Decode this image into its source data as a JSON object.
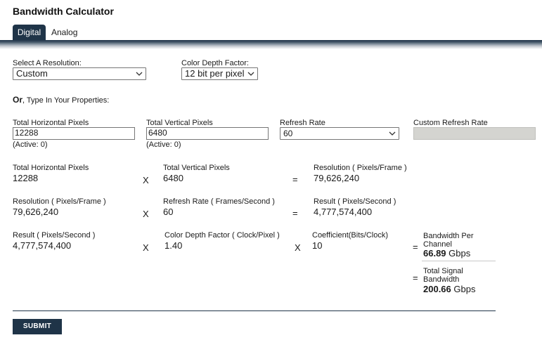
{
  "app": {
    "title": "Bandwidth Calculator"
  },
  "tabs": [
    {
      "label": "Digital",
      "active": true
    },
    {
      "label": "Analog",
      "active": false
    }
  ],
  "form": {
    "resolution_label": "Select A Resolution:",
    "resolution_value": "Custom",
    "color_depth_label": "Color Depth Factor:",
    "color_depth_value": "12 bit per pixel",
    "or_text": "Or",
    "or_rest": ", Type In Your Properties:",
    "h_pixels_label": "Total Horizontal Pixels",
    "h_pixels_value": "12288",
    "h_pixels_active": "(Active: 0)",
    "v_pixels_label": "Total Vertical Pixels",
    "v_pixels_value": "6480",
    "v_pixels_active": "(Active: 0)",
    "refresh_label": "Refresh Rate",
    "refresh_value": "60",
    "custom_refresh_label": "Custom Refresh Rate",
    "custom_refresh_value": ""
  },
  "calc": {
    "row1": {
      "a_label": "Total Horizontal Pixels",
      "a_value": "12288",
      "op1": "X",
      "b_label": "Total Vertical Pixels",
      "b_value": "6480",
      "op2": "=",
      "r_label": "Resolution ( Pixels/Frame )",
      "r_value": "79,626,240"
    },
    "row2": {
      "a_label": "Resolution ( Pixels/Frame )",
      "a_value": "79,626,240",
      "op1": "X",
      "b_label": "Refresh Rate ( Frames/Second )",
      "b_value": "60",
      "op2": "=",
      "r_label": "Result ( Pixels/Second )",
      "r_value": "4,777,574,400"
    },
    "row3": {
      "a_label": "Result ( Pixels/Second )",
      "a_value": "4,777,574,400",
      "op1": "X",
      "b_label": "Color Depth Factor ( Clock/Pixel )",
      "b_value": "1.40",
      "op2": "X",
      "c_label": "Coefficient(Bits/Clock)",
      "c_value": "10",
      "op3": "=",
      "bw_label_1": "Bandwidth Per",
      "bw_label_2": "Channel",
      "bw_value": "66.89",
      "bw_unit": "Gbps"
    },
    "total": {
      "op": "=",
      "label_1": "Total Signal",
      "label_2": "Bandwidth",
      "value": "200.66",
      "unit": "Gbps"
    }
  },
  "submit_label": "SUBMIT",
  "colors": {
    "accent": "#1f3448"
  }
}
